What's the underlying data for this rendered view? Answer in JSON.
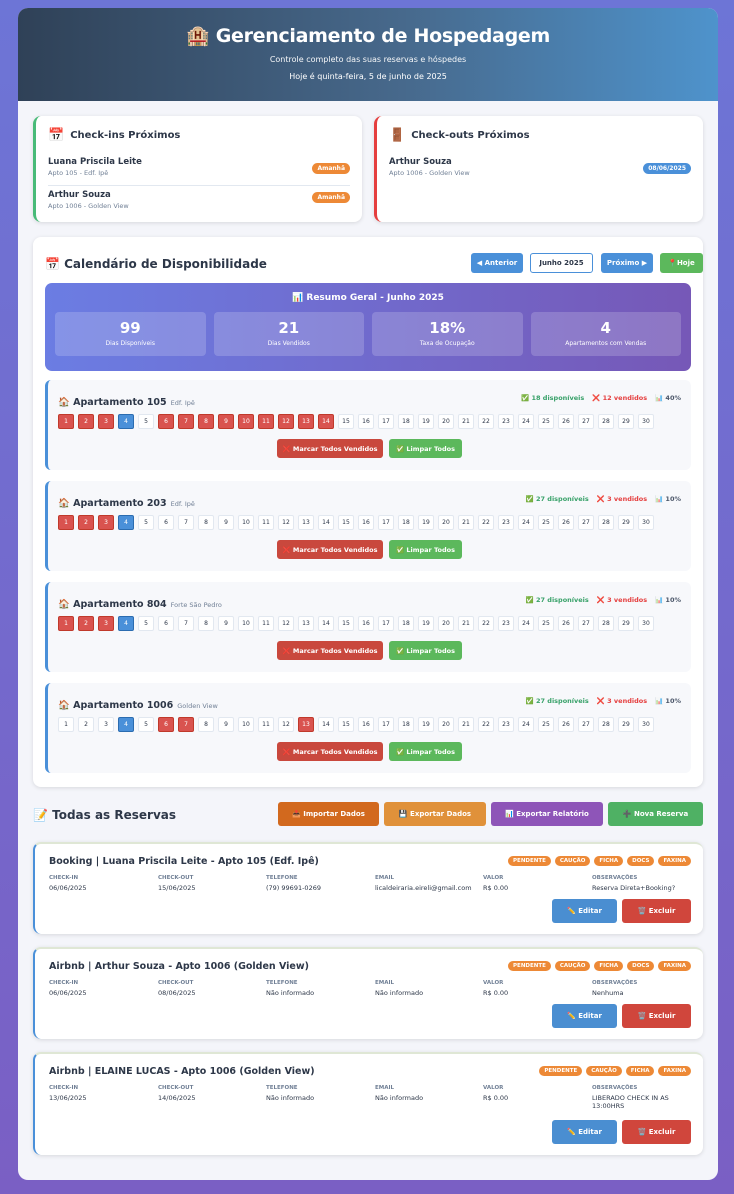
{
  "header": {
    "title": "🏨 Gerenciamento de Hospedagem",
    "subtitle": "Controle completo das suas reservas e hóspedes",
    "date": "Hoje é quinta-feira, 5 de junho de 2025"
  },
  "checkins": {
    "title": "Check-ins Próximos",
    "icon": "📅",
    "items": [
      {
        "name": "Luana Priscila Leite",
        "apt": "Apto 105 - Edf. Ipê",
        "badge": "Amanhã"
      },
      {
        "name": "Arthur Souza",
        "apt": "Apto 1006 - Golden View",
        "badge": "Amanhã"
      }
    ]
  },
  "checkouts": {
    "title": "Check-outs Próximos",
    "icon": "🚪",
    "items": [
      {
        "name": "Arthur Souza",
        "apt": "Apto 1006 - Golden View",
        "badge": "08/06/2025"
      }
    ]
  },
  "calendar": {
    "title": "📅 Calendário de Disponibilidade",
    "prev_label": "◀ Anterior",
    "month_label": "Junho 2025",
    "next_label": "Próximo ▶",
    "today_label": "📍Hoje",
    "summary": {
      "title": "📊 Resumo Geral - Junho 2025",
      "stats": [
        {
          "value": "99",
          "label": "Dias Disponíveis"
        },
        {
          "value": "21",
          "label": "Dias Vendidos"
        },
        {
          "value": "18%",
          "label": "Taxa de Ocupação"
        },
        {
          "value": "4",
          "label": "Apartamentos com Vendas"
        }
      ]
    },
    "today_day": 4,
    "mark_all_label": "❌ Marcar Todos Vendidos",
    "clear_all_label": "✅ Limpar Todos",
    "apartments": [
      {
        "name": "🏠 Apartamento 105",
        "building": "Edf. Ipê",
        "available": "✅ 18 disponíveis",
        "sold": "❌ 12 vendidos",
        "rate": "📊 40%",
        "sold_days": [
          1,
          2,
          3,
          6,
          7,
          8,
          9,
          10,
          11,
          12,
          13,
          14
        ]
      },
      {
        "name": "🏠 Apartamento 203",
        "building": "Edf. Ipê",
        "available": "✅ 27 disponíveis",
        "sold": "❌ 3 vendidos",
        "rate": "📊 10%",
        "sold_days": [
          1,
          2,
          3
        ]
      },
      {
        "name": "🏠 Apartamento 804",
        "building": "Forte São Pedro",
        "available": "✅ 27 disponíveis",
        "sold": "❌ 3 vendidos",
        "rate": "📊 10%",
        "sold_days": [
          1,
          2,
          3
        ]
      },
      {
        "name": "🏠 Apartamento 1006",
        "building": "Golden View",
        "available": "✅ 27 disponíveis",
        "sold": "❌ 3 vendidos",
        "rate": "📊 10%",
        "sold_days": [
          6,
          7,
          13
        ]
      }
    ]
  },
  "reservations_bar": {
    "title": "📝 Todas as Reservas",
    "import_label": "📥 Importar Dados",
    "export_label": "💾 Exportar Dados",
    "report_label": "📊 Exportar Relatório",
    "new_label": "➕ Nova Reserva"
  },
  "field_labels": {
    "checkin": "CHECK-IN",
    "checkout": "CHECK-OUT",
    "phone": "TELEFONE",
    "email": "EMAIL",
    "value": "VALOR",
    "notes": "OBSERVAÇÕES"
  },
  "edit_label": "✏️ Editar",
  "delete_label": "🗑️ Excluir",
  "reservations": [
    {
      "title": "Booking | Luana Priscila Leite - Apto 105 (Edf. Ipê)",
      "tags": [
        "PENDENTE",
        "CAUÇÃO",
        "FICHA",
        "DOCS",
        "FAXINA"
      ],
      "checkin": "06/06/2025",
      "checkout": "15/06/2025",
      "phone": "(79) 99691-0269",
      "email": "licaldeiraria.eireli@gmail.com",
      "value": "R$ 0.00",
      "notes": "Reserva Direta+Booking?"
    },
    {
      "title": "Airbnb | Arthur Souza - Apto 1006 (Golden View)",
      "tags": [
        "PENDENTE",
        "CAUÇÃO",
        "FICHA",
        "DOCS",
        "FAXINA"
      ],
      "checkin": "06/06/2025",
      "checkout": "08/06/2025",
      "phone": "Não informado",
      "email": "Não informado",
      "value": "R$ 0.00",
      "notes": "Nenhuma"
    },
    {
      "title": "Airbnb | ELAINE LUCAS - Apto 1006 (Golden View)",
      "tags": [
        "PENDENTE",
        "CAUÇÃO",
        "FICHA",
        "FAXINA"
      ],
      "checkin": "13/06/2025",
      "checkout": "14/06/2025",
      "phone": "Não informado",
      "email": "Não informado",
      "value": "R$ 0.00",
      "notes": "LIBERADO CHECK IN AS 13:00HRS"
    }
  ]
}
